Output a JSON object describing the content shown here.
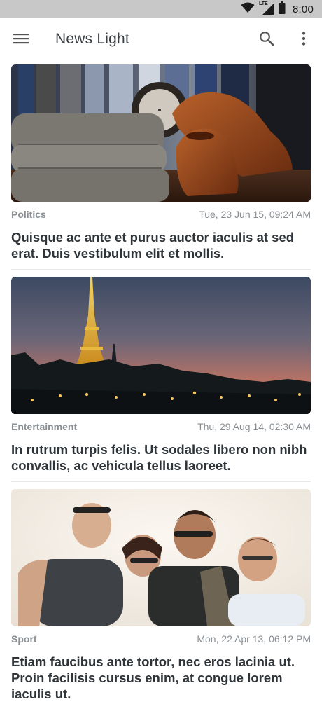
{
  "status_bar": {
    "time": "8:00",
    "network_label": "LTE",
    "icons": [
      "wifi-icon",
      "cellular-signal-icon",
      "battery-icon"
    ]
  },
  "app_bar": {
    "title": "News Light",
    "icons": [
      "menu-icon",
      "search-icon",
      "more-vert-icon"
    ]
  },
  "articles": [
    {
      "category": "Politics",
      "date": "Tue, 23 Jun 15, 09:24 AM",
      "headline": "Quisque ac ante et purus auctor iaculis at sed erat. Duis vestibulum elit et mollis.",
      "image": "shoes-and-sweaters-photo"
    },
    {
      "category": "Entertainment",
      "date": "Thu, 29 Aug 14, 02:30 AM",
      "headline": "In rutrum turpis felis. Ut sodales libero non nibh convallis, ac vehicula tellus laoreet.",
      "image": "eiffel-tower-dusk-photo"
    },
    {
      "category": "Sport",
      "date": "Mon, 22 Apr 13, 06:12 PM",
      "headline": "Etiam faucibus ante tortor, nec eros lacinia ut. Proin facilisis cursus enim, at congue lorem iaculis ut.",
      "image": "laughing-friends-photo"
    }
  ],
  "colors": {
    "status_bar_bg": "#c8c8c8",
    "app_bar_bg": "#ffffff",
    "headline_text": "#2f3439",
    "meta_text": "#8a8f94"
  }
}
